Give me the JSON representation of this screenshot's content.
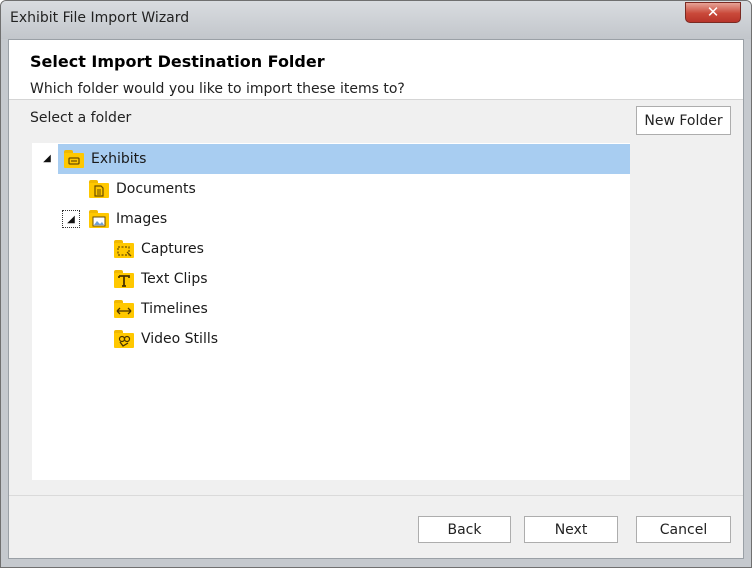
{
  "window": {
    "title": "Exhibit File Import Wizard",
    "close_label": "✕"
  },
  "header": {
    "title": "Select Import Destination Folder",
    "subtitle": "Which folder would you like to import these items to?"
  },
  "folder_label": "Select a folder",
  "new_folder_button": "New Folder",
  "tree": {
    "items": [
      {
        "label": "Exhibits",
        "icon": "card-icon",
        "level": 0,
        "expanded": true,
        "selected": true
      },
      {
        "label": "Documents",
        "icon": "document-icon",
        "level": 1
      },
      {
        "label": "Images",
        "icon": "picture-icon",
        "level": 1,
        "expanded": true
      },
      {
        "label": "Captures",
        "icon": "capture-icon",
        "level": 2
      },
      {
        "label": "Text Clips",
        "icon": "text-icon",
        "level": 2
      },
      {
        "label": "Timelines",
        "icon": "timeline-arrow-icon",
        "level": 2
      },
      {
        "label": "Video Stills",
        "icon": "film-reel-icon",
        "level": 2
      }
    ],
    "expander_glyph": "◢"
  },
  "buttons": {
    "back": "Back",
    "next": "Next",
    "cancel": "Cancel"
  },
  "colors": {
    "selection": "#a8cdf1",
    "folder": "#ffc800",
    "close": "#c9493a"
  }
}
